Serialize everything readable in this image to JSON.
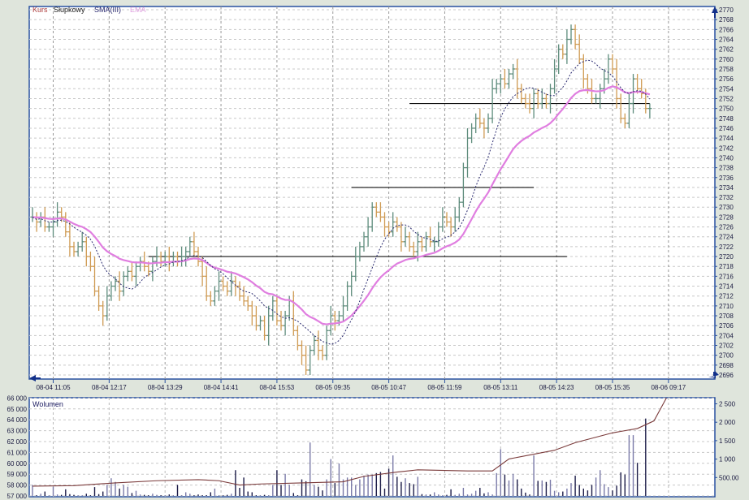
{
  "legend": {
    "kurs": "Kurs",
    "type": "Słupkowy",
    "sma": "SMA(III)",
    "ema": "EMA"
  },
  "colors": {
    "up": "#5e8c7c",
    "down": "#cf9a52",
    "sma": "#2a2a70",
    "ema": "#e07ee0",
    "axis": "#2850a0",
    "volume_up": "#7a7aa8",
    "volume_down": "#1c1c48",
    "volume_line": "#7a3a3a"
  },
  "chart_data": [
    {
      "type": "ohlc",
      "title": "",
      "ylim": [
        2696,
        2770
      ],
      "y_ticks": [
        "2696",
        "2698",
        "2700",
        "2702",
        "2704",
        "2706",
        "2708",
        "2710",
        "2712",
        "2714",
        "2716",
        "2718",
        "2720",
        "2722",
        "2724",
        "2726",
        "2728",
        "2730",
        "2732",
        "2734",
        "2736",
        "2738",
        "2740",
        "2742",
        "2744",
        "2746",
        "2748",
        "2750",
        "2752",
        "2754",
        "2756",
        "2758",
        "2760",
        "2762",
        "2764",
        "2766",
        "2768",
        "2770"
      ],
      "x_tick_labels": [
        "08-04 11:05",
        "08-04 12:17",
        "08-04 13:29",
        "08-04 14:41",
        "08-04 15:53",
        "08-05 09:35",
        "08-05 10:47",
        "08-05 11:59",
        "08-05 13:11",
        "08-05 14:23",
        "08-05 15:35",
        "08-06 09:17"
      ],
      "bars_per_x_tick": 13.5,
      "first_tick_bar": 5,
      "close": [
        2728,
        2727,
        2728,
        2726,
        2726,
        2727,
        2729,
        2728,
        2725,
        2722,
        2721,
        2722,
        2723,
        2720,
        2718,
        2713,
        2710,
        2708,
        2712,
        2714,
        2715,
        2713,
        2716,
        2717,
        2716,
        2718,
        2719,
        2718,
        2717,
        2719,
        2720,
        2719,
        2720,
        2719,
        2720,
        2719,
        2720,
        2721,
        2723,
        2721,
        2719,
        2716,
        2712,
        2711,
        2713,
        2715,
        2714,
        2713,
        2715,
        2714,
        2712,
        2711,
        2710,
        2708,
        2706,
        2707,
        2704,
        2708,
        2711,
        2707,
        2706,
        2708,
        2711,
        2705,
        2702,
        2700,
        2697,
        2701,
        2703,
        2701,
        2700,
        2705,
        2708,
        2707,
        2708,
        2710,
        2714,
        2716,
        2720,
        2722,
        2724,
        2726,
        2730,
        2729,
        2728,
        2726,
        2725,
        2727,
        2726,
        2723,
        2724,
        2722,
        2721,
        2723,
        2722,
        2724,
        2723,
        2723,
        2726,
        2728,
        2727,
        2726,
        2728,
        2731,
        2738,
        2744,
        2746,
        2748,
        2747,
        2746,
        2748,
        2754,
        2755,
        2756,
        2755,
        2757,
        2758,
        2754,
        2752,
        2751,
        2750,
        2753,
        2751,
        2752,
        2751,
        2754,
        2758,
        2762,
        2761,
        2764,
        2766,
        2763,
        2760,
        2756,
        2754,
        2752,
        2752,
        2754,
        2756,
        2760,
        2758,
        2752,
        2748,
        2747,
        2751,
        2756,
        2754,
        2753,
        2750,
        2750
      ],
      "hlines": [
        {
          "value": 2720,
          "from_bar": 28,
          "to_bar": 129
        },
        {
          "value": 2734,
          "from_bar": 77,
          "to_bar": 121
        },
        {
          "value": 2751,
          "from_bar": 91,
          "to_bar": 149
        }
      ],
      "series": [
        {
          "name": "SMA(III)",
          "period": 10
        },
        {
          "name": "EMA",
          "period": 25
        }
      ]
    },
    {
      "type": "bar",
      "title": "Wolumen",
      "left_ylim": [
        57000,
        66000
      ],
      "left_ticks": [
        "57 000",
        "58 000",
        "59 000",
        "60 000",
        "61 000",
        "62 000",
        "63 000",
        "64 000",
        "65 000",
        "66 000"
      ],
      "right_ylim": [
        0,
        2650
      ],
      "right_ticks": [
        "500.00",
        "1 000",
        "1 500",
        "2 000",
        "2 500"
      ],
      "volume": [
        300,
        20,
        60,
        120,
        20,
        250,
        40,
        30,
        180,
        50,
        30,
        20,
        20,
        60,
        20,
        240,
        50,
        120,
        300,
        480,
        380,
        200,
        300,
        250,
        80,
        140,
        40,
        30,
        20,
        60,
        30,
        20,
        20,
        40,
        20,
        300,
        20,
        100,
        60,
        20,
        40,
        20,
        20,
        100,
        200,
        20,
        20,
        30,
        60,
        700,
        220,
        500,
        120,
        100,
        20,
        20,
        30,
        20,
        300,
        700,
        300,
        600,
        300,
        80,
        20,
        450,
        400,
        1450,
        300,
        250,
        150,
        450,
        1000,
        350,
        880,
        450,
        500,
        500,
        300,
        450,
        550,
        580,
        580,
        620,
        650,
        200,
        740,
        1100,
        520,
        380,
        480,
        350,
        320,
        520,
        50,
        40,
        40,
        100,
        40,
        20,
        30,
        180,
        30,
        60,
        220,
        40,
        60,
        140,
        220,
        70,
        100,
        40,
        620,
        1270,
        580,
        420,
        600,
        450,
        200,
        90,
        40,
        1100,
        410,
        420,
        380,
        440,
        140,
        100,
        120,
        200,
        350,
        550,
        300,
        200,
        150,
        300,
        500,
        700,
        320,
        240,
        150,
        280,
        640,
        580,
        1650,
        1650,
        900,
        0,
        2100,
        0
      ],
      "line": [
        [
          0,
          57900
        ],
        [
          10,
          57950
        ],
        [
          20,
          58200
        ],
        [
          30,
          58400
        ],
        [
          40,
          58500
        ],
        [
          45,
          58400
        ],
        [
          50,
          58000
        ],
        [
          55,
          58100
        ],
        [
          65,
          58200
        ],
        [
          75,
          58300
        ],
        [
          80,
          58800
        ],
        [
          88,
          59200
        ],
        [
          93,
          59400
        ],
        [
          105,
          59300
        ],
        [
          111,
          59300
        ],
        [
          115,
          60400
        ],
        [
          126,
          61200
        ],
        [
          131,
          61900
        ],
        [
          140,
          62800
        ],
        [
          146,
          63200
        ],
        [
          150,
          63900
        ],
        [
          153,
          66000
        ]
      ]
    }
  ]
}
